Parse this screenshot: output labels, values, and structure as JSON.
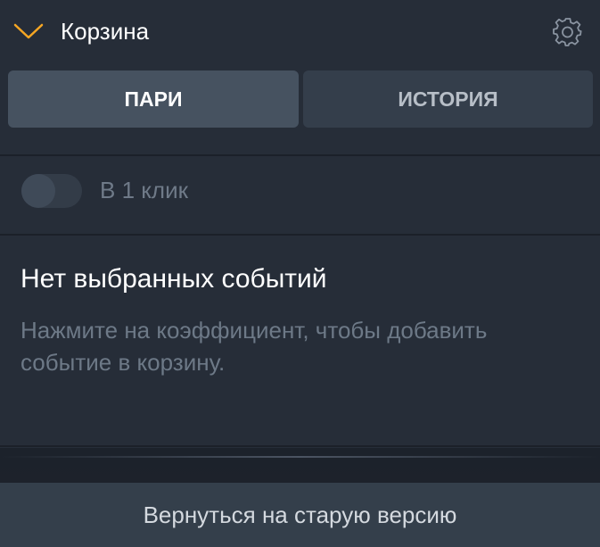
{
  "header": {
    "title": "Корзина",
    "collapse_icon": "chevron-down-icon",
    "settings_icon": "gear-icon",
    "accent_color": "#f5a623"
  },
  "tabs": [
    {
      "label": "ПАРИ",
      "active": true
    },
    {
      "label": "ИСТОРИЯ",
      "active": false
    }
  ],
  "one_click": {
    "label": "В 1 клик",
    "enabled": false
  },
  "empty_state": {
    "title": "Нет выбранных событий",
    "text": "Нажмите на коэффициент, чтобы добавить событие в корзину."
  },
  "footer": {
    "button_label": "Вернуться на старую версию"
  }
}
